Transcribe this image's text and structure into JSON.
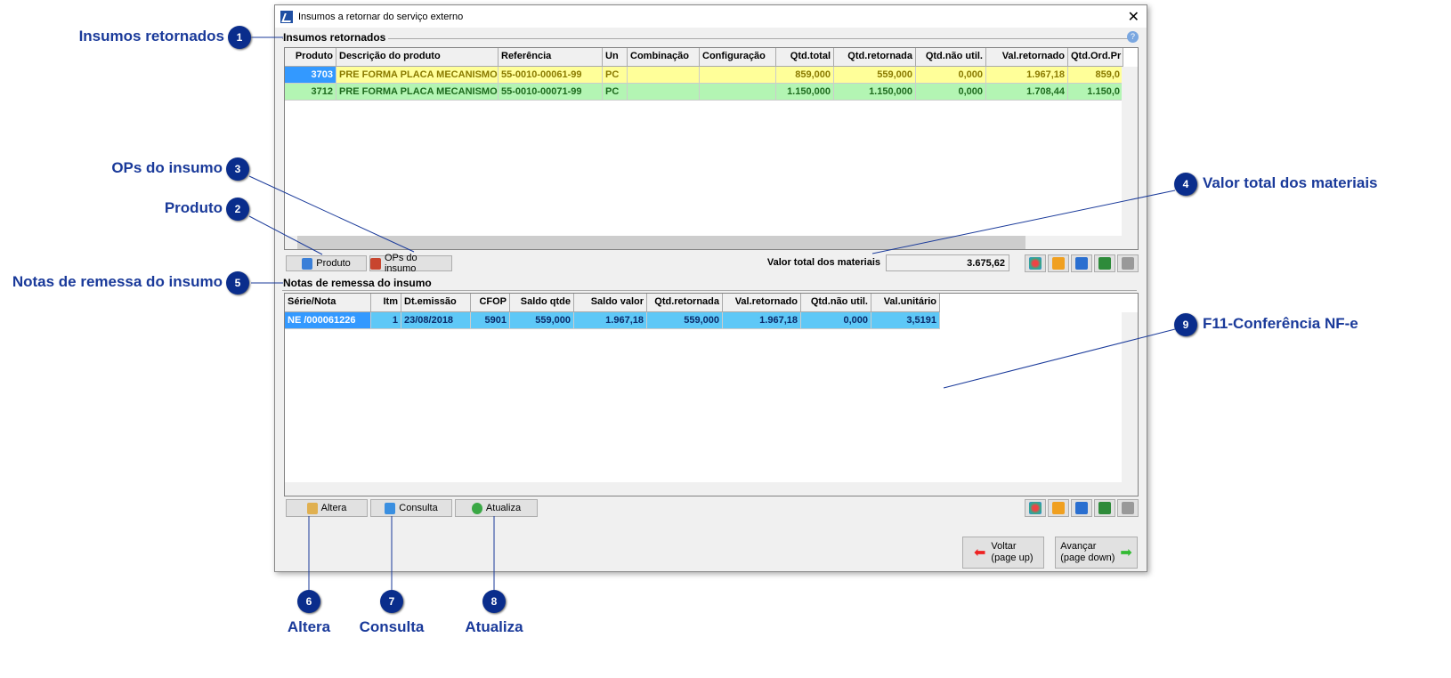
{
  "window": {
    "title": "Insumos a retornar do serviço externo",
    "close": "✕"
  },
  "group1": {
    "label": "Insumos retornados",
    "headers": [
      "Produto",
      "Descrição do produto",
      "Referência",
      "Un",
      "Combinação",
      "Configuração",
      "Qtd.total",
      "Qtd.retornada",
      "Qtd.não util.",
      "Val.retornado",
      "Qtd.Ord.Pr"
    ],
    "rows": [
      [
        "3703",
        "PRE FORMA PLACA MECANISMO",
        "55-0010-00061-99",
        "PC",
        "",
        "",
        "859,000",
        "559,000",
        "0,000",
        "1.967,18",
        "859,0"
      ],
      [
        "3712",
        "PRE FORMA PLACA MECANISMO",
        "55-0010-00071-99",
        "PC",
        "",
        "",
        "1.150,000",
        "1.150,000",
        "0,000",
        "1.708,44",
        "1.150,0"
      ]
    ]
  },
  "buttons1": {
    "produto": "Produto",
    "ops": "OPs do insumo"
  },
  "total": {
    "label": "Valor total dos materiais",
    "value": "3.675,62"
  },
  "group2": {
    "label": "Notas de remessa do insumo",
    "headers": [
      "Série/Nota",
      "Itm",
      "Dt.emissão",
      "CFOP",
      "Saldo qtde",
      "Saldo valor",
      "Qtd.retornada",
      "Val.retornado",
      "Qtd.não util.",
      "Val.unitário"
    ],
    "rows": [
      [
        "NE /000061226",
        "1",
        "23/08/2018",
        "5901",
        "559,000",
        "1.967,18",
        "559,000",
        "1.967,18",
        "0,000",
        "3,5191"
      ]
    ]
  },
  "buttons2": {
    "altera": "Altera",
    "consulta": "Consulta",
    "atualiza": "Atualiza"
  },
  "nav": {
    "voltar": "Voltar",
    "voltar_hint": "(page up)",
    "avancar": "Avançar",
    "avancar_hint": "(page down)"
  },
  "callouts": [
    {
      "n": "1",
      "label": "Insumos retornados"
    },
    {
      "n": "2",
      "label": "Produto"
    },
    {
      "n": "3",
      "label": "OPs do insumo"
    },
    {
      "n": "4",
      "label": "Valor total dos materiais"
    },
    {
      "n": "5",
      "label": "Notas de remessa do insumo"
    },
    {
      "n": "6",
      "label": "Altera"
    },
    {
      "n": "7",
      "label": "Consulta"
    },
    {
      "n": "8",
      "label": "Atualiza"
    },
    {
      "n": "9",
      "label": "F11-Conferência NF-e"
    }
  ],
  "colors": {
    "callout": "#0a2d8c",
    "callout_text": "#1a3a9a",
    "row_yellow": "#ffff99",
    "row_green": "#b3f5b3",
    "row_blue": "#5ec8f7"
  }
}
